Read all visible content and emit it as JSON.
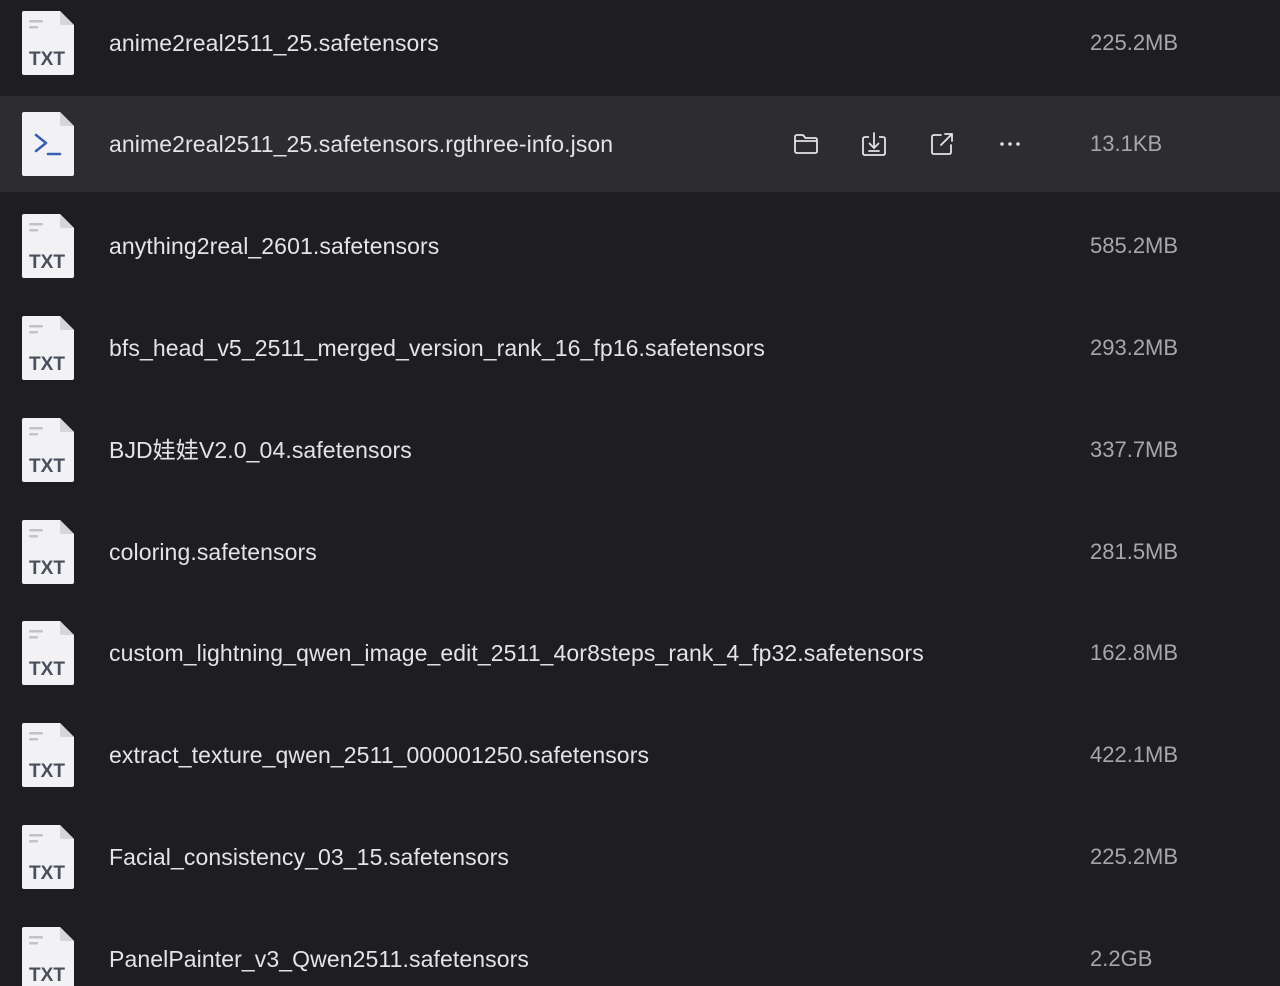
{
  "colors": {
    "background": "#1e1e22",
    "row_hover": "#2c2c31",
    "file_name": "#e4e4e7",
    "file_size": "#a6a6ad",
    "icon_paper": "#f2f2f4",
    "icon_text": "#4a4f5c"
  },
  "files": [
    {
      "name": "anime2real2511_25.safetensors",
      "size": "225.2MB",
      "icon": "txt-file-icon",
      "icon_label": "TXT"
    },
    {
      "name": "anime2real2511_25.safetensors.rgthree-info.json",
      "size": "13.1KB",
      "icon": "script-file-icon",
      "icon_label": ">_",
      "hovered": true
    },
    {
      "name": "anything2real_2601.safetensors",
      "size": "585.2MB",
      "icon": "txt-file-icon",
      "icon_label": "TXT"
    },
    {
      "name": "bfs_head_v5_2511_merged_version_rank_16_fp16.safetensors",
      "size": "293.2MB",
      "icon": "txt-file-icon",
      "icon_label": "TXT"
    },
    {
      "name": "BJD娃娃V2.0_04.safetensors",
      "size": "337.7MB",
      "icon": "txt-file-icon",
      "icon_label": "TXT"
    },
    {
      "name": "coloring.safetensors",
      "size": "281.5MB",
      "icon": "txt-file-icon",
      "icon_label": "TXT"
    },
    {
      "name": "custom_lightning_qwen_image_edit_2511_4or8steps_rank_4_fp32.safetensors",
      "size": "162.8MB",
      "icon": "txt-file-icon",
      "icon_label": "TXT"
    },
    {
      "name": "extract_texture_qwen_2511_000001250.safetensors",
      "size": "422.1MB",
      "icon": "txt-file-icon",
      "icon_label": "TXT"
    },
    {
      "name": "Facial_consistency_03_15.safetensors",
      "size": "225.2MB",
      "icon": "txt-file-icon",
      "icon_label": "TXT"
    },
    {
      "name": "PanelPainter_v3_Qwen2511.safetensors",
      "size": "2.2GB",
      "icon": "txt-file-icon",
      "icon_label": "TXT"
    }
  ],
  "row_actions": [
    {
      "icon": "folder-icon",
      "action": "open-folder"
    },
    {
      "icon": "download-icon",
      "action": "download"
    },
    {
      "icon": "external-link-icon",
      "action": "open-external"
    },
    {
      "icon": "more-icon",
      "action": "more"
    }
  ]
}
